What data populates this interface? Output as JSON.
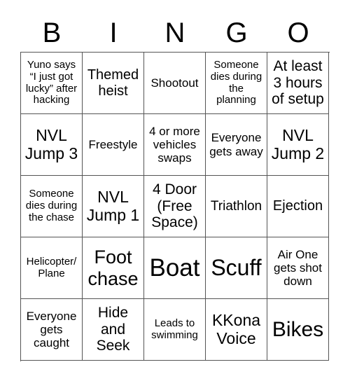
{
  "header": [
    "B",
    "I",
    "N",
    "G",
    "O"
  ],
  "cells": [
    "Yuno says “I just got lucky” after hacking",
    "Themed heist",
    "Shootout",
    "Someone dies during the planning",
    "At least 3 hours of setup",
    "NVL Jump 3",
    "Freestyle",
    "4 or more vehicles swaps",
    "Everyone gets away",
    "NVL Jump 2",
    "Someone dies during the chase",
    "NVL Jump 1",
    "4 Door (Free Space)",
    "Triathlon",
    "Ejection",
    "Helicopter/ Plane",
    "Foot chase",
    "Boat",
    "Scuff",
    "Air One gets shot down",
    "Everyone gets caught",
    "Hide and Seek",
    "Leads to swimming",
    "KKona Voice",
    "Bikes"
  ]
}
